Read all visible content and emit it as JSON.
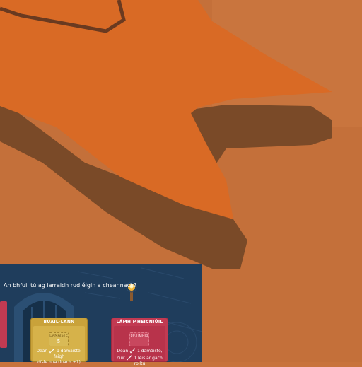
{
  "dialog": {
    "prompt": "An bhfuil tú ag iarraidh rud éigin a cheannach?"
  },
  "cards": [
    {
      "title": "BUAIL-LANN",
      "slot_label": "DAMÁISTE",
      "slot_value": "5",
      "desc_line1_pre": "Déan",
      "desc_line1_post": "1 damáiste, faigh",
      "desc_line2": "dísle nua (luach +1)"
    },
    {
      "title": "LÁMH MHEICNIÚIL",
      "slot_label": "RÉ-UMHIR",
      "desc_line1_pre": "Déan",
      "desc_line1_post": "1 damáiste,",
      "desc_line2_pre": "cuir",
      "desc_line2_post": "1 leis ar gach rolltú"
    }
  ],
  "colors": {
    "floor": "#c8733c",
    "arrow": "#d96a25",
    "shadow": "#7a4a28",
    "panel": "#1f3d5c",
    "card_yellow": "#c9a23a",
    "card_red": "#c23a52"
  },
  "icons": [
    "arrow-cursor-icon",
    "torch-icon",
    "sword-icon",
    "door-icon"
  ]
}
